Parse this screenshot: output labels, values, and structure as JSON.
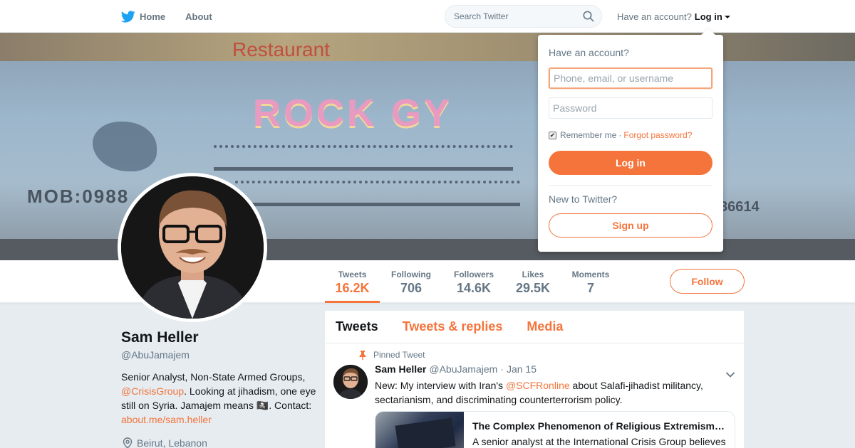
{
  "colors": {
    "accent": "#f4743b",
    "twitter_blue": "#1da1f2",
    "text": "#14171a",
    "muted": "#657786"
  },
  "nav": {
    "home_label": "Home",
    "about_label": "About",
    "search_placeholder": "Search Twitter",
    "have_account": "Have an account?",
    "login_label": "Log in"
  },
  "banner": {
    "restaurant": "Restaurant",
    "sign_name": "ROCK GY",
    "mob": "MOB:0988",
    "phone_tail": "36614"
  },
  "profile": {
    "name": "Sam Heller",
    "handle": "@AbuJamajem",
    "bio_1": "Senior Analyst, Non-State Armed Groups, ",
    "bio_link_1": "@CrisisGroup",
    "bio_2": ". Looking at jihadism, one eye still on Syria. Jamajem means 🏴‍☠️. Contact: ",
    "bio_link_2": "about.me/sam.heller",
    "location": "Beirut, Lebanon"
  },
  "stats": [
    {
      "label": "Tweets",
      "value": "16.2K",
      "active": true
    },
    {
      "label": "Following",
      "value": "706"
    },
    {
      "label": "Followers",
      "value": "14.6K"
    },
    {
      "label": "Likes",
      "value": "29.5K"
    },
    {
      "label": "Moments",
      "value": "7"
    }
  ],
  "follow_label": "Follow",
  "timeline": {
    "tabs": [
      "Tweets",
      "Tweets & replies",
      "Media"
    ],
    "pinned_label": "Pinned Tweet",
    "tweet": {
      "name": "Sam Heller",
      "handle": "@AbuJamajem",
      "date": "Jan 15",
      "text_1": "New: My interview with Iran's ",
      "text_link": "@SCFRonline",
      "text_2": " about Salafi-jihadist militancy, sectarianism, and discriminating counterterrorism policy.",
      "card_title": "The Complex Phenomenon of Religious Extremism…",
      "card_desc": "A senior analyst at the International Crisis Group believes"
    }
  },
  "login_dropdown": {
    "question": "Have an account?",
    "username_placeholder": "Phone, email, or username",
    "password_placeholder": "Password",
    "remember_label": "Remember me",
    "separator": "·",
    "forgot_label": "Forgot password?",
    "remember_checked": true,
    "login_button": "Log in",
    "new_label": "New to Twitter?",
    "signup_button": "Sign up"
  },
  "icons": {
    "bird": "twitter-bird-icon",
    "search": "search-icon",
    "caret": "caret-down-icon",
    "pin": "pin-icon",
    "location": "location-pin-icon",
    "chevron": "chevron-down-icon"
  }
}
